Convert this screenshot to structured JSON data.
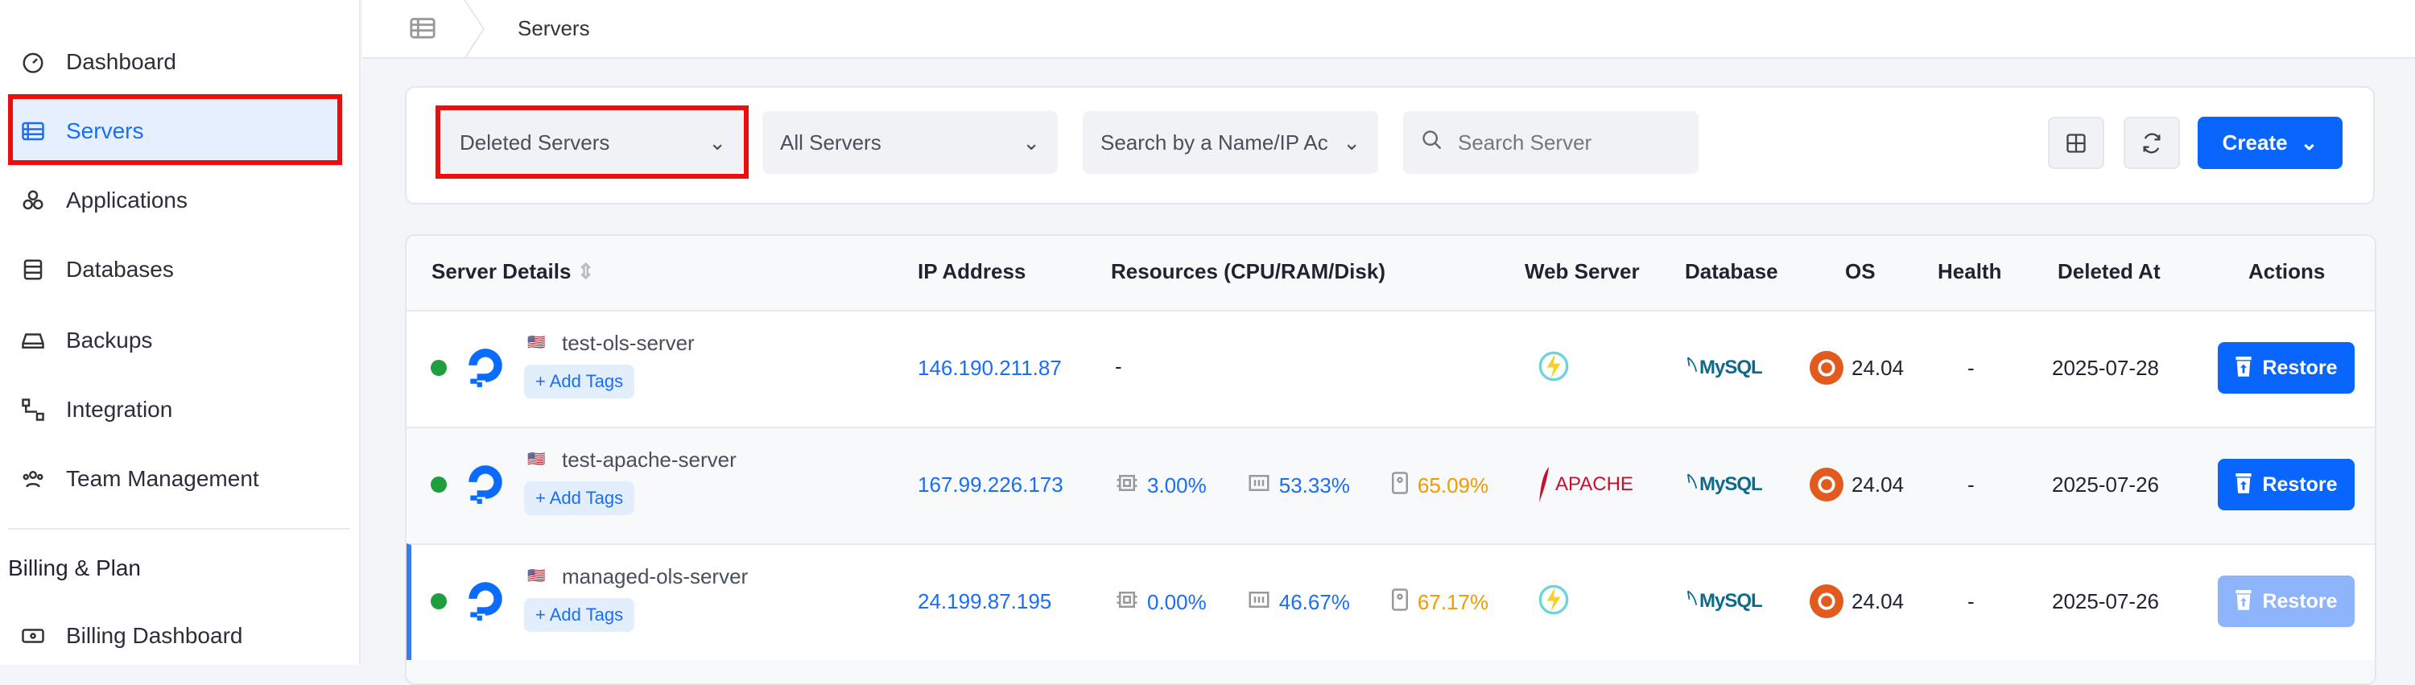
{
  "sidebar": {
    "items": [
      {
        "label": "Dashboard",
        "icon": "gauge-icon"
      },
      {
        "label": "Servers",
        "icon": "server-icon",
        "active": true
      },
      {
        "label": "Applications",
        "icon": "apps-icon"
      },
      {
        "label": "Databases",
        "icon": "database-icon"
      },
      {
        "label": "Backups",
        "icon": "backup-icon"
      },
      {
        "label": "Integration",
        "icon": "integration-icon"
      },
      {
        "label": "Team Management",
        "icon": "team-icon"
      }
    ],
    "section": "Billing & Plan",
    "billing_item": "Billing Dashboard"
  },
  "breadcrumb": {
    "current": "Servers"
  },
  "filters": {
    "status": "Deleted Servers",
    "scope": "All Servers",
    "search_by": "Search by a Name/IP Ac",
    "search_placeholder": "Search Server",
    "create": "Create"
  },
  "table": {
    "headers": [
      "Server Details",
      "IP Address",
      "Resources (CPU/RAM/Disk)",
      "Web Server",
      "Database",
      "OS",
      "Health",
      "Deleted At",
      "Actions"
    ],
    "add_tags": "+ Add Tags",
    "restore": "Restore",
    "database": "MySQL",
    "apache": "APACHE",
    "rows": [
      {
        "name": "test-ols-server",
        "ip": "146.190.211.87",
        "resources": "-",
        "cpu": null,
        "ram": null,
        "disk": null,
        "web": "litespeed",
        "os": "24.04",
        "health": "-",
        "deleted": "2025-07-28",
        "restore_enabled": true
      },
      {
        "name": "test-apache-server",
        "ip": "167.99.226.173",
        "cpu": "3.00%",
        "ram": "53.33%",
        "disk": "65.09%",
        "web": "apache",
        "os": "24.04",
        "health": "-",
        "deleted": "2025-07-26",
        "restore_enabled": true
      },
      {
        "name": "managed-ols-server",
        "ip": "24.199.87.195",
        "cpu": "0.00%",
        "ram": "46.67%",
        "disk": "67.17%",
        "web": "litespeed",
        "os": "24.04",
        "health": "-",
        "deleted": "2025-07-26",
        "restore_enabled": false
      }
    ]
  },
  "colors": {
    "accent": "#0866ff",
    "highlight": "#ee0d0d",
    "online": "#1e9e3e",
    "disk": "#f29a00"
  }
}
